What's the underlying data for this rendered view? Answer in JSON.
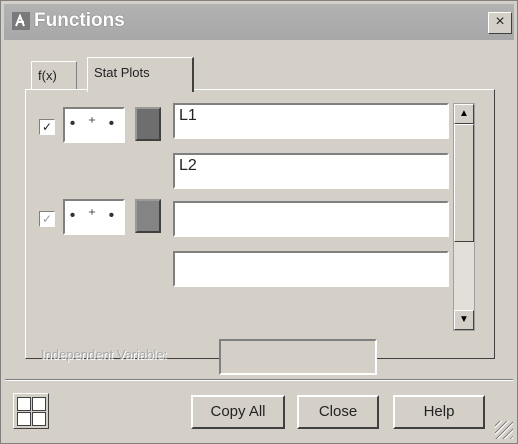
{
  "window": {
    "title": "Functions",
    "close_glyph": "×"
  },
  "tabs": [
    {
      "label": "f(x)",
      "active": false
    },
    {
      "label": "Stat Plots",
      "active": true
    }
  ],
  "plots": [
    {
      "checked": true,
      "style_glyph": "• ⁺ •",
      "swatch_color": "#6e6e6e",
      "fields": [
        "L1",
        "L2"
      ]
    },
    {
      "checked": true,
      "dimmed": true,
      "style_glyph": "• ⁺ •",
      "swatch_color": "#848484",
      "fields": [
        "",
        ""
      ]
    }
  ],
  "scrollbar": {
    "up_glyph": "▲",
    "down_glyph": "▼"
  },
  "independent_variable": {
    "label": "Independent Variable:",
    "value": ""
  },
  "buttons": {
    "copy_all": "Copy All",
    "close": "Close",
    "help": "Help"
  },
  "icons": {
    "title": "functions-window-icon",
    "grid": "grid-layout-icon"
  },
  "colors": {
    "titlebar": "#a8a8a8",
    "dialog": "#d4d0c8"
  }
}
